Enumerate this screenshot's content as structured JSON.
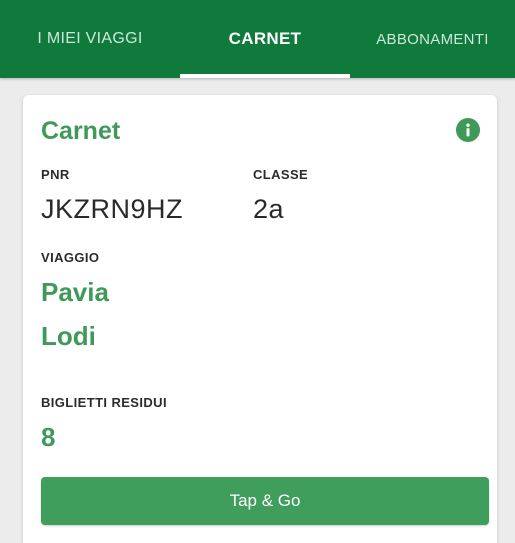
{
  "tabs": {
    "items": [
      {
        "label": "I MIEI VIAGGI"
      },
      {
        "label": "CARNET"
      },
      {
        "label": "ABBONAMENTI"
      }
    ],
    "selected": "CARNET"
  },
  "card": {
    "title": "Carnet",
    "pnr_label": "PNR",
    "pnr_value": "JKZRN9HZ",
    "class_label": "CLASSE",
    "class_value": "2a",
    "trip_label": "VIAGGIO",
    "origin": "Pavia",
    "destination": "Lodi",
    "remaining_label": "BIGLIETTI RESIDUI",
    "remaining_value": "8",
    "info_icon": "info-icon",
    "button_label": "Tap & Go"
  },
  "colors": {
    "header": "#0f7a3c",
    "accent": "#3f9a5a",
    "button": "#3f9e5c"
  }
}
